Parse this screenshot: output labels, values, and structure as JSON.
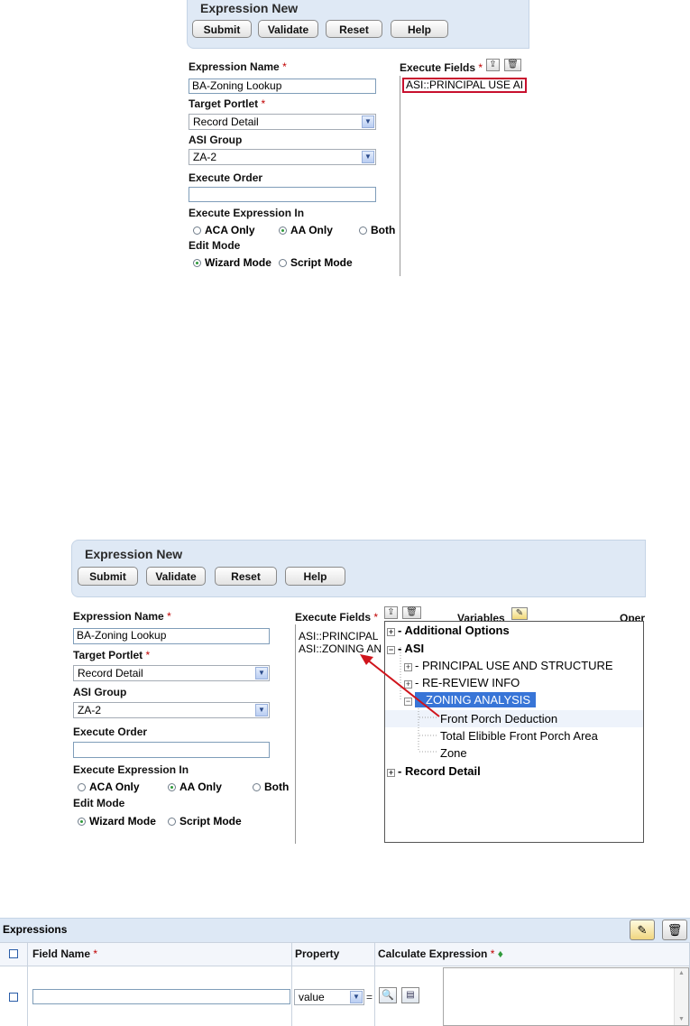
{
  "panel1": {
    "title": "Expression New",
    "buttons": {
      "submit": "Submit",
      "validate": "Validate",
      "reset": "Reset",
      "help": "Help"
    },
    "expression_name_label": "Expression Name",
    "expression_name_value": "BA-Zoning Lookup",
    "target_portlet_label": "Target Portlet",
    "target_portlet_value": "Record Detail",
    "asi_group_label": "ASI Group",
    "asi_group_value": "ZA-2",
    "execute_order_label": "Execute Order",
    "execute_in_label": "Execute Expression In",
    "execute_in_options": [
      "ACA Only",
      "AA Only",
      "Both"
    ],
    "execute_in_selected": "AA Only",
    "edit_mode_label": "Edit Mode",
    "edit_mode_options": [
      "Wizard Mode",
      "Script Mode"
    ],
    "edit_mode_selected": "Wizard Mode",
    "execute_fields_label": "Execute Fields",
    "execute_fields_items": [
      "ASI::PRINCIPAL USE AI"
    ],
    "required_mark": "*"
  },
  "panel2": {
    "title": "Expression New",
    "buttons": {
      "submit": "Submit",
      "validate": "Validate",
      "reset": "Reset",
      "help": "Help"
    },
    "expression_name_label": "Expression Name",
    "expression_name_value": "BA-Zoning Lookup",
    "target_portlet_label": "Target Portlet",
    "target_portlet_value": "Record Detail",
    "asi_group_label": "ASI Group",
    "asi_group_value": "ZA-2",
    "execute_order_label": "Execute Order",
    "execute_in_label": "Execute Expression In",
    "execute_in_options": [
      "ACA Only",
      "AA Only",
      "Both"
    ],
    "execute_in_selected": "AA Only",
    "edit_mode_label": "Edit Mode",
    "edit_mode_options": [
      "Wizard Mode",
      "Script Mode"
    ],
    "edit_mode_selected": "Wizard Mode",
    "execute_fields_label": "Execute Fields",
    "execute_fields_items": [
      "ASI::PRINCIPAL",
      "ASI::ZONING AN"
    ],
    "variables_label": "Variables",
    "operators_label_partial": "Oper",
    "required_mark": "*",
    "tree": {
      "additional_options": "Additional Options",
      "asi": "ASI",
      "principal_use": "PRINCIPAL USE AND STRUCTURE",
      "re_review": "RE-REVIEW INFO",
      "zoning_analysis": "ZONING ANALYSIS",
      "front_porch": "Front Porch Deduction",
      "total_elibible": "Total Elibible Front Porch Area",
      "zone": "Zone",
      "record_detail": "Record Detail"
    }
  },
  "expressions": {
    "title": "Expressions",
    "columns": {
      "field_name": "Field Name",
      "property": "Property",
      "calculate": "Calculate Expression"
    },
    "required_mark": "*",
    "diamond": "♦",
    "property_value": "value",
    "equals": "="
  },
  "colors": {
    "accent_blue": "#3875d7",
    "header_bg": "#dfe9f5",
    "required": "#c00000",
    "arrow": "#d0141c"
  }
}
